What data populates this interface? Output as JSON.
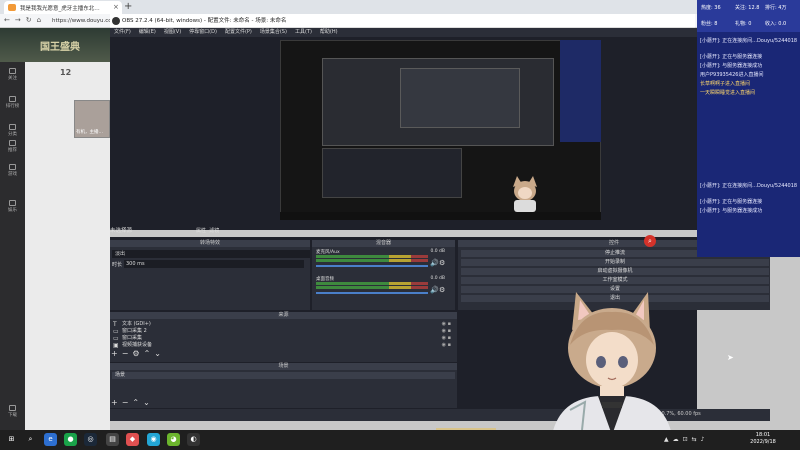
{
  "browser": {
    "tab_title": "我是我我光愿意_虎牙主播东北…",
    "url": "https://www.douyu.com",
    "new_tab_icon": "plus-icon"
  },
  "douyu_page": {
    "banner_text": "国王盛典",
    "rail_items": [
      "关注",
      "排行榜",
      "分类",
      "推荐",
      "游戏",
      "娱乐",
      "下载"
    ],
    "feed_count": "12",
    "feed_card_label": "有机，主播…"
  },
  "obs": {
    "title": "OBS 27.2.4 (64-bit, windows) - 配置文件: 未命名 - 场景: 未命名",
    "menu": [
      "文件(F)",
      "编辑(E)",
      "视图(V)",
      "停靠窗口(D)",
      "配置文件(P)",
      "场景集合(S)",
      "工具(T)",
      "帮助(H)"
    ],
    "scenes_label": "未选择源",
    "scene_buttons": [
      "属性",
      "滤镜"
    ],
    "transitions": {
      "header": "转场特效",
      "selected": "淡出",
      "duration_label": "时长",
      "duration_value": "300 ms"
    },
    "mixer": {
      "header": "混音器",
      "channels": [
        {
          "name": "麦克风/Aux",
          "db": "0.0 dB"
        },
        {
          "name": "桌面音频",
          "db": "0.0 dB"
        }
      ]
    },
    "controls": {
      "header": "控件",
      "buttons": [
        "停止推流",
        "开始录制",
        "启动虚拟摄像机",
        "工作室模式",
        "设置",
        "退出"
      ]
    },
    "sources": {
      "header": "来源",
      "items": [
        "文本 (GDI+)",
        "窗口采集 2",
        "窗口采集",
        "视频捕获设备"
      ]
    },
    "scenes": {
      "header": "场景",
      "items": [
        "场景"
      ]
    },
    "status": "CPU: 0.7%, 60.00 fps"
  },
  "chat_overlay": {
    "stats": {
      "hot": "热度: 36",
      "follow": "关注: 12.8",
      "fan": "粉丝: 8",
      "gift": "礼物: 0",
      "rank": "排行: 4万",
      "money": "收入: 0.0"
    },
    "lines": [
      {
        "text": "[小蘑开]: 正在连接房间...Douyu/5244018",
        "highlight": false
      },
      {
        "text": "[小蘑开]: 正在与服务器连接",
        "highlight": false
      },
      {
        "text": "[小蘑开]: 与服务器连接成功",
        "highlight": false
      },
      {
        "text": "用户P93935426进入直播间",
        "highlight": false
      },
      {
        "text": "长草啊啊子进入直播间",
        "highlight": true
      },
      {
        "text": "一天瞬瞬睡觉进入直播间",
        "highlight": true
      },
      {
        "text": "[小蘑开]: 正在连接房间...Douyu/5244018",
        "highlight": false
      },
      {
        "text": "[小蘑开]: 正在与服务器连接",
        "highlight": false
      },
      {
        "text": "[小蘑开]: 与服务器连接成功",
        "highlight": false
      }
    ]
  },
  "taskbar": {
    "time": "18:01",
    "date": "2022/9/18",
    "icons": [
      "windows-icon",
      "search-icon",
      "task-view-icon",
      "edge-icon",
      "file-explorer-icon",
      "steam-icon",
      "app-icon",
      "game-icon",
      "chrome-icon",
      "obs-icon"
    ]
  }
}
